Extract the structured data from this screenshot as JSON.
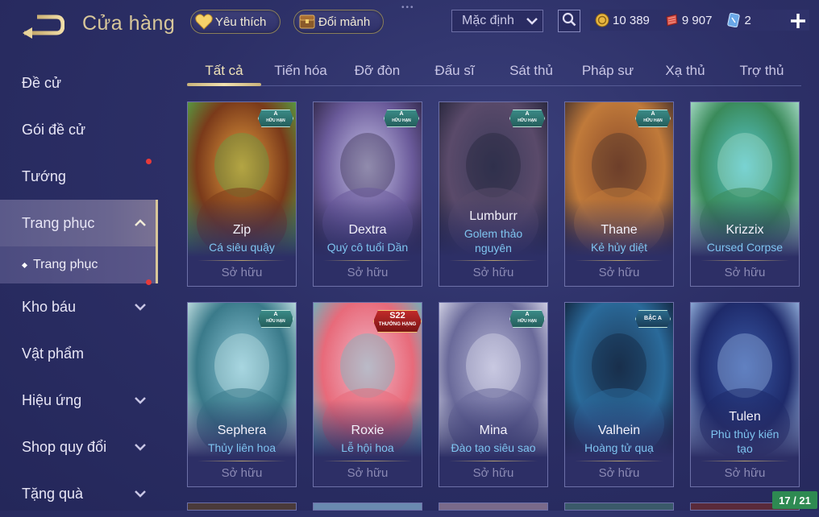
{
  "header": {
    "title": "Cửa hàng",
    "favorites_label": "Yêu thích",
    "shard_label": "Đổi mảnh",
    "sort_value": "Mặc định",
    "currencies": [
      {
        "icon": "gold-coin-icon",
        "value": "10 389"
      },
      {
        "icon": "red-gem-icon",
        "value": "9 907"
      },
      {
        "icon": "voucher-card-icon",
        "value": "2"
      }
    ]
  },
  "sidebar": {
    "items": [
      {
        "label": "Đề cử"
      },
      {
        "label": "Gói đề cử"
      },
      {
        "label": "Tướng"
      },
      {
        "label": "Trang phục"
      },
      {
        "label": "Kho báu"
      },
      {
        "label": "Vật phẩm"
      },
      {
        "label": "Hiệu ứng"
      },
      {
        "label": "Shop quy đổi"
      },
      {
        "label": "Tặng quà"
      }
    ],
    "subitem": "Trang phục"
  },
  "tabs": [
    "Tất cả",
    "Tiến hóa",
    "Đỡ đòn",
    "Đấu sĩ",
    "Sát thủ",
    "Pháp sư",
    "Xạ thủ",
    "Trợ thủ"
  ],
  "cards": [
    {
      "hero": "Zip",
      "skin": "Cá siêu quậy",
      "status": "Sở hữu",
      "badge": "A",
      "badge_sub": "HỮU HẠN"
    },
    {
      "hero": "Dextra",
      "skin": "Quý cô tuổi Dần",
      "status": "Sở hữu",
      "badge": "A",
      "badge_sub": "HỮU HẠN"
    },
    {
      "hero": "Lumburr",
      "skin": "Golem thảo nguyên",
      "status": "Sở hữu",
      "badge": "A",
      "badge_sub": "HỮU HẠN"
    },
    {
      "hero": "Thane",
      "skin": "Kẻ hủy diệt",
      "status": "Sở hữu",
      "badge": "A",
      "badge_sub": "HỮU HẠN"
    },
    {
      "hero": "Krizzix",
      "skin": "Cursed Corpse",
      "status": "Sở hữu",
      "badge": "",
      "badge_sub": ""
    },
    {
      "hero": "Sephera",
      "skin": "Thủy liên hoa",
      "status": "Sở hữu",
      "badge": "A",
      "badge_sub": "HỮU HẠN"
    },
    {
      "hero": "Roxie",
      "skin": "Lễ hội hoa",
      "status": "Sở hữu",
      "badge": "S22",
      "badge_sub": "THƯỞNG HẠNG"
    },
    {
      "hero": "Mina",
      "skin": "Đào tạo siêu sao",
      "status": "Sở hữu",
      "badge": "A",
      "badge_sub": "HỮU HẠN"
    },
    {
      "hero": "Valhein",
      "skin": "Hoàng tử quạ",
      "status": "Sở hữu",
      "badge": "BẬC A",
      "badge_sub": ""
    },
    {
      "hero": "Tulen",
      "skin": "Phù thủy kiến tạo",
      "status": "Sở hữu",
      "badge": "",
      "badge_sub": ""
    }
  ],
  "page_counter": "17 / 21",
  "colors": {
    "accent_gold": "#d8c79a",
    "skin_name": "#7ec4f0",
    "background": "#2c2f66"
  }
}
